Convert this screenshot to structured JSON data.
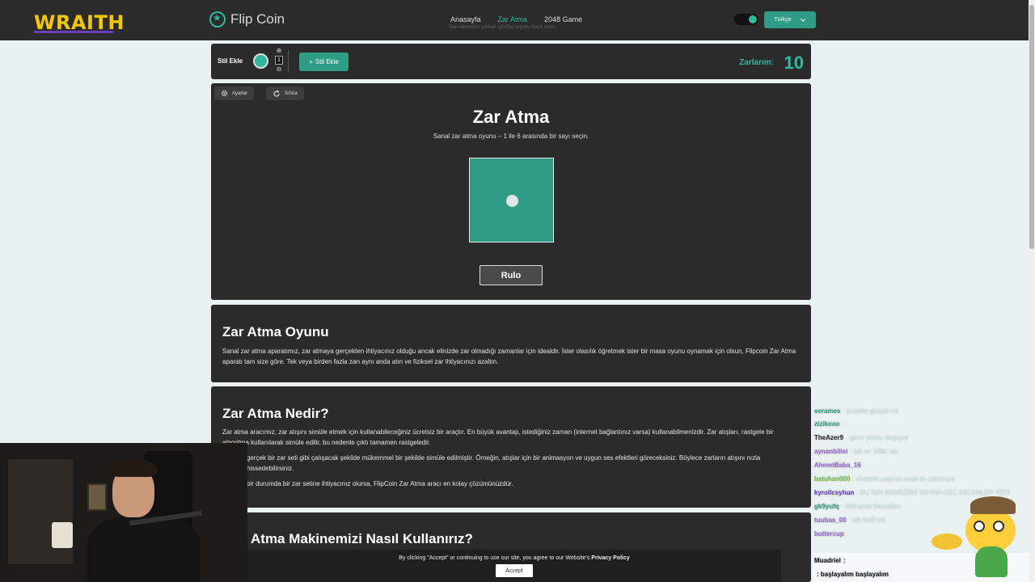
{
  "brand": {
    "name": "WRAITH"
  },
  "site": {
    "logo_text": "Flip Coin"
  },
  "nav": {
    "items": [
      "Anasayfa",
      "Zar Atma",
      "2048 Game"
    ],
    "hint": "Tam ekrandan çıkmak için Esc tuşunu basılı tutun"
  },
  "language": {
    "label": "Türkçe"
  },
  "style_bar": {
    "label": "Stil Ekle",
    "count": "1",
    "add_button": "Stil Ekle",
    "score_label": "Zarlarım:",
    "score_value": "10"
  },
  "dice": {
    "settings_label": "Ayarlar",
    "reset_label": "Sıfırla",
    "title": "Zar Atma",
    "subtitle": "Sanal zar atma oyunu – 1 ile 6 arasında bir sayı seçin.",
    "face_value": 1,
    "roll_button": "Rulo",
    "die_color": "#2f9c85"
  },
  "sections": [
    {
      "title": "Zar Atma Oyunu",
      "paragraphs": [
        "Sanal zar atma aparatımız, zar atmaya gerçekten ihtiyacınız olduğu ancak elinizde zar olmadığı zamanlar için idealdir. İster olasılık öğretmek ister bir masa oyunu oynamak için olsun, Flipcoin Zar Atma aparatı tam size göre. Tek veya birden fazla zarı aynı anda atın ve fiziksel zar ihtiyacınızı azaltın."
      ]
    },
    {
      "title": "Zar Atma Nedir?",
      "paragraphs": [
        "Zar atma aracımız, zar atışını simüle etmek için kullanabileceğiniz ücretsiz bir araçtır. En büyük avantajı, istediğiniz zaman (internet bağlantınız varsa) kullanabilmenizdir. Zar atışları, rastgele bir algoritma kullanılarak simüle edilir, bu nedenle çıktı tamamen rastgeledir.",
        "gerçek bir zar seti gibi çalışacak şekilde mükemmel bir şekilde simüle edilmiştir. Örneğin, atışlar için bir animasyon ve uygun ses efektleri göreceksiniz. Böylece zarların atışını nızla hissedebilirsiniz.",
        "bir durumda bir zar setine ihtiyacınız olursa, FlipCoin Zar Atma aracı en kolay çözümünüzdür."
      ]
    },
    {
      "title": "Atma Makinemizi Nasıl Kullanırız?"
    }
  ],
  "cookie": {
    "text": "By clicking \"Accept\" or continuing to use our site, you agree to our Website's",
    "link": "Privacy Policy",
    "accept": "Accept"
  },
  "chat": {
    "messages": [
      {
        "user": "serames",
        "user_color": "#2f9c85",
        "text": ": puanlar gerçek mi",
        "bold": false
      },
      {
        "user": "zizikooo",
        "user_color": "#2f9c85",
        "text": ":",
        "bold": false
      },
      {
        "user": "TheAzer9",
        "user_color": "#2a2a2a",
        "text": ": gene yanlış oluşuyor",
        "bold": false
      },
      {
        "user": "aynanbilisi",
        "user_color": "#9a6ad1",
        "text": ": tek sır 100k var",
        "bold": false
      },
      {
        "user": "AhmetBaba_16",
        "user_color": "#9a6ad1",
        "text": ":",
        "bold": false
      },
      {
        "user": "batuhan000",
        "user_color": "#7ac14b",
        "text": ": chatone yapcan puan ile yaramıyo",
        "bold": false
      },
      {
        "user": "kyrollcsyhun",
        "user_color": "#6b3ec7",
        "text": ": BU İŞİN EKMEĞİNİ YAYINA GEÇ GELENLER YEDİ",
        "bold": false
      },
      {
        "user": "gk9yufq",
        "user_color": "#2f9c85",
        "text": ": 600 puan barcadım",
        "bold": false
      },
      {
        "user": "tuubaa_00",
        "user_color": "#9a6ad1",
        "text": ": tek hadi tek",
        "bold": false
      },
      {
        "user": "buttercup",
        "user_color": "#9a6ad1",
        "text": ":",
        "bold": false
      },
      {
        "user": "Muadriel",
        "user_color": "#111111",
        "text": ":",
        "bold": true
      },
      {
        "user": "",
        "user_color": "#9a6ad1",
        "text": ": başlayalım başlayalım",
        "bold": true
      }
    ]
  }
}
